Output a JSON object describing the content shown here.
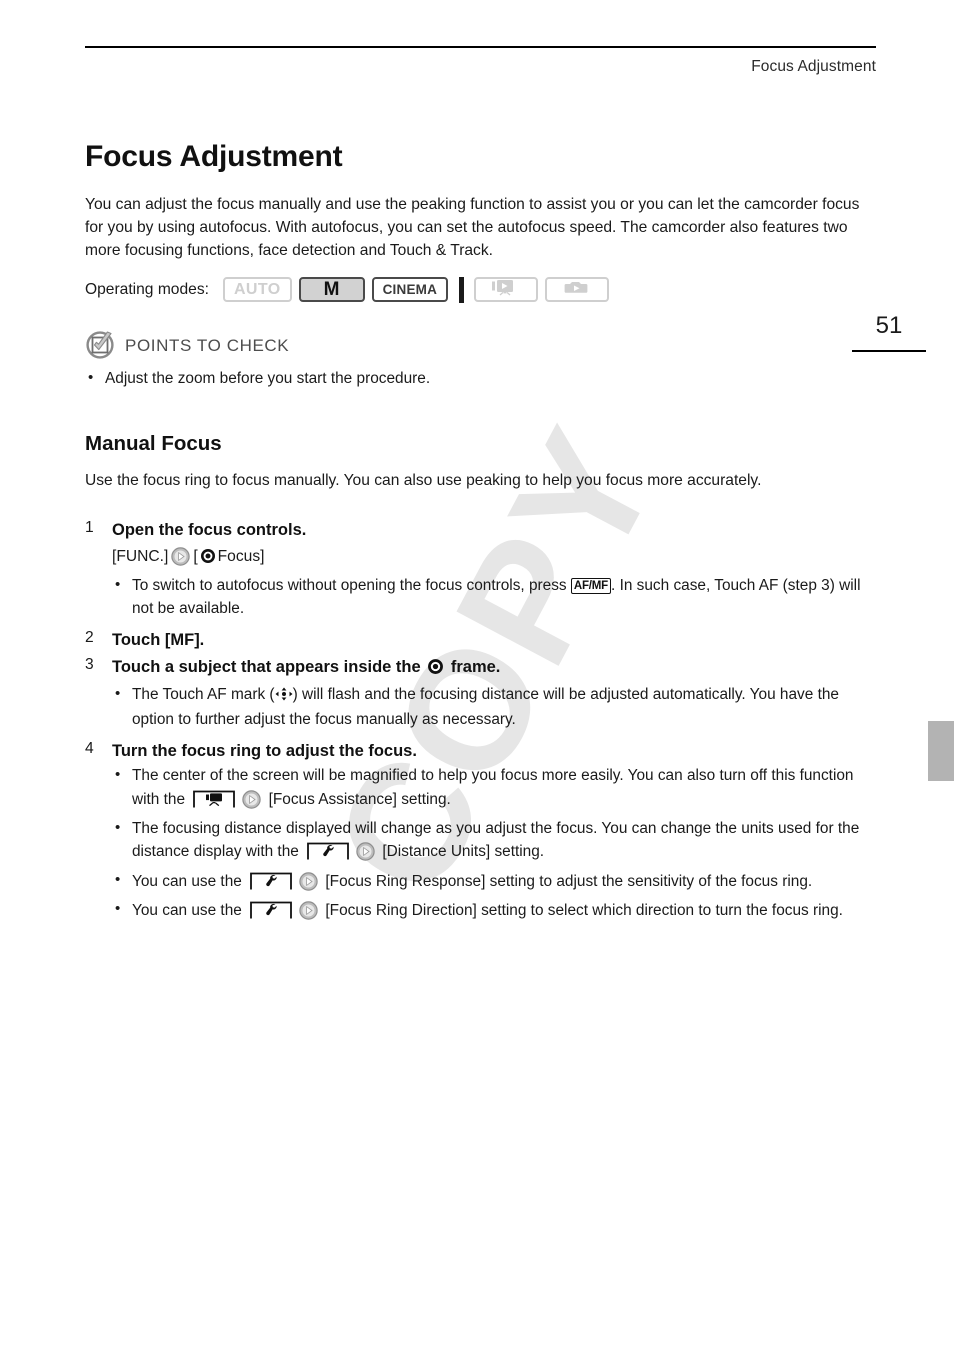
{
  "header": {
    "running_head": "Focus Adjustment"
  },
  "folio": {
    "page_number": "51"
  },
  "watermark": {
    "text": "COPY"
  },
  "main": {
    "title": "Focus Adjustment",
    "intro": "You can adjust the focus manually and use the peaking function to assist you or you can let the camcorder focus for you by using autofocus. With autofocus, you can set the autofocus speed. The camcorder also features two more focusing functions, face detection and Touch & Track."
  },
  "operating_modes": {
    "label": "Operating modes:",
    "chips": [
      {
        "label": "AUTO",
        "state": "off",
        "icon": ""
      },
      {
        "label": "M",
        "state": "on-filled",
        "icon": ""
      },
      {
        "label": "CINEMA",
        "state": "on-outline",
        "icon": ""
      },
      {
        "label": "",
        "state": "off",
        "icon": "video-playback-icon"
      },
      {
        "label": "",
        "state": "off",
        "icon": "photo-playback-icon"
      }
    ]
  },
  "points_to_check": {
    "icon": "checkbox-check-circle-icon",
    "heading": "POINTS TO CHECK",
    "items": [
      "Adjust the zoom before you start the procedure."
    ]
  },
  "manual_focus": {
    "heading": "Manual Focus",
    "intro": "Use the focus ring to focus manually. You can also use peaking to help you focus more accurately.",
    "steps": [
      {
        "num": "1",
        "head": "Open the focus controls.",
        "path_prefix": "[FUNC.]",
        "path_suffix": "Focus]",
        "path_open_bracket": "[",
        "bullets": [
          {
            "pre": "To switch to autofocus without opening the focus controls, press ",
            "key": "AF/MF",
            "post": ". In such case, Touch AF (step 3) will not be available."
          }
        ]
      },
      {
        "num": "2",
        "head_pre": "Touch [",
        "head_key": "MF",
        "head_post": "].",
        "bullets": []
      },
      {
        "num": "3",
        "head_pre": "Touch a subject that appears inside the ",
        "head_post": " frame.",
        "bullets": [
          {
            "pre": "The Touch AF mark (",
            "post": ") will flash and the focusing distance will be adjusted automatically. You have the option to further adjust the focus manually as necessary."
          }
        ]
      },
      {
        "num": "4",
        "head": "Turn the focus ring to adjust the focus.",
        "bullets": [
          {
            "pre": "The center of the screen will be magnified to help you focus more easily. You can also turn off this function with the ",
            "menu_icon": "camcorder-icon",
            "post": "[Focus Assistance] setting."
          },
          {
            "pre": "The focusing distance displayed will change as you adjust the focus. You can change the units used for the distance display with the ",
            "menu_icon": "wrench-icon",
            "post": "[Distance Units] setting."
          },
          {
            "pre": "You can use the ",
            "menu_icon": "wrench-icon",
            "post": "[Focus Ring Response] setting to adjust the sensitivity of the focus ring."
          },
          {
            "pre": "You can use the ",
            "menu_icon": "wrench-icon",
            "post": "[Focus Ring Direction] setting to select which direction to turn the focus ring."
          }
        ]
      }
    ]
  }
}
